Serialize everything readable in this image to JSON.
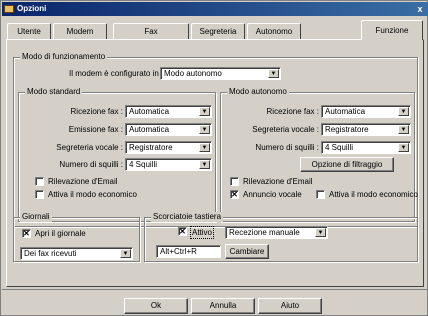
{
  "window": {
    "title": "Opzioni",
    "close_glyph": "x"
  },
  "tabs": [
    "Utente",
    "Modem",
    "Fax",
    "Segreteria",
    "Autonomo",
    "Funzione"
  ],
  "mode_group": {
    "legend": "Modo di funzionamento",
    "label": "Il modem è configurato in",
    "value": "Modo autonomo"
  },
  "standard_group": {
    "legend": "Modo standard",
    "rows": [
      {
        "label": "Ricezione fax :",
        "value": "Automatica"
      },
      {
        "label": "Emissione fax :",
        "value": "Automatica"
      },
      {
        "label": "Segreteria vocale :",
        "value": "Registratore"
      },
      {
        "label": "Numero di squilli :",
        "value": "4 Squilli"
      }
    ],
    "checks": [
      {
        "label": "Rilevazione d'Email",
        "checked": false
      },
      {
        "label": "Attiva il modo economico",
        "checked": false
      }
    ]
  },
  "autonomous_group": {
    "legend": "Modo autonomo",
    "rows": [
      {
        "label": "Ricezione fax :",
        "value": "Automatica"
      },
      {
        "label": "Segreteria vocale :",
        "value": "Registratore"
      },
      {
        "label": "Numero di squilli :",
        "value": "4 Squilli"
      }
    ],
    "filter_button": "Opzione di filtraggio",
    "checks": [
      {
        "label": "Rilevazione d'Email",
        "checked": false
      },
      {
        "label": "Annuncio vocale",
        "checked": true
      },
      {
        "label": "Attiva il modo economico",
        "checked": false
      }
    ]
  },
  "journals_group": {
    "legend": "Giornali",
    "check": {
      "label": "Apri il giornale",
      "checked": true
    },
    "value": "Dei fax ricevuti"
  },
  "shortcut_group": {
    "legend": "Scorciatoie tastiera",
    "check": {
      "label": "Attivo",
      "checked": true
    },
    "value": "Recezione manuale",
    "keys": "Alt+Ctrl+R",
    "change_button": "Cambiare"
  },
  "buttons": {
    "ok": "Ok",
    "cancel": "Annulla",
    "help": "Aiuto"
  },
  "glyphs": {
    "arrow": "▼",
    "check": "✕"
  }
}
